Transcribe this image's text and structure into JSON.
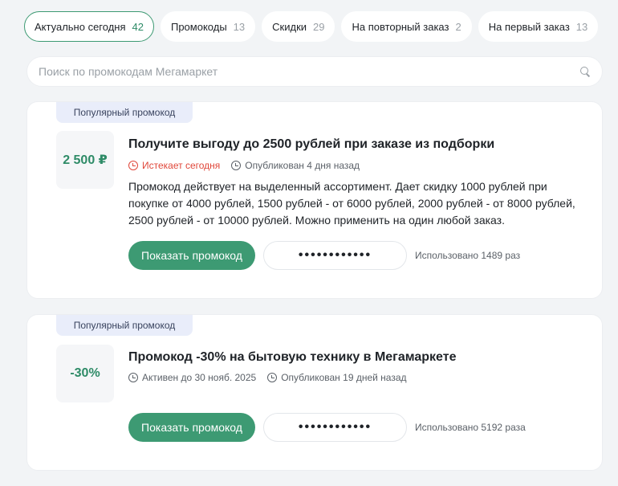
{
  "tabs": [
    {
      "label": "Актуально сегодня",
      "count": "42",
      "active": true
    },
    {
      "label": "Промокоды",
      "count": "13"
    },
    {
      "label": "Скидки",
      "count": "29"
    },
    {
      "label": "На повторный заказ",
      "count": "2"
    },
    {
      "label": "На первый заказ",
      "count": "13"
    }
  ],
  "search": {
    "placeholder": "Поиск по промокодам Мегамаркет",
    "icon": "search-icon"
  },
  "cards": [
    {
      "badge": "Популярный промокод",
      "value": "2 500 ₽",
      "title": "Получите выгоду до 2500 рублей при заказе из подборки",
      "expire": "Истекает сегодня",
      "published": "Опубликован 4 дня назад",
      "description": "Промокод действует на выделенный ассортимент. Дает скидку 1000 рублей при покупке от 4000 рублей, 1500 рублей - от 6000 рублей, 2000 рублей - от 8000 рублей, 2500 рублей - от 10000 рублей. Можно применить на один любой заказ.",
      "button": "Показать промокод",
      "code_mask": "••••••••••••",
      "used": "Использовано 1489 раз"
    },
    {
      "badge": "Популярный промокод",
      "value": "-30%",
      "title": "Промокод -30% на бытовую технику в Мегамаркете",
      "active_until": "Активен до 30 нояб. 2025",
      "published": "Опубликован 19 дней назад",
      "button": "Показать промокод",
      "code_mask": "••••••••••••",
      "used": "Использовано 5192 раза"
    }
  ],
  "colors": {
    "accent": "#3d9a73",
    "expire": "#e0473a",
    "badge_bg": "#e9edfa"
  }
}
